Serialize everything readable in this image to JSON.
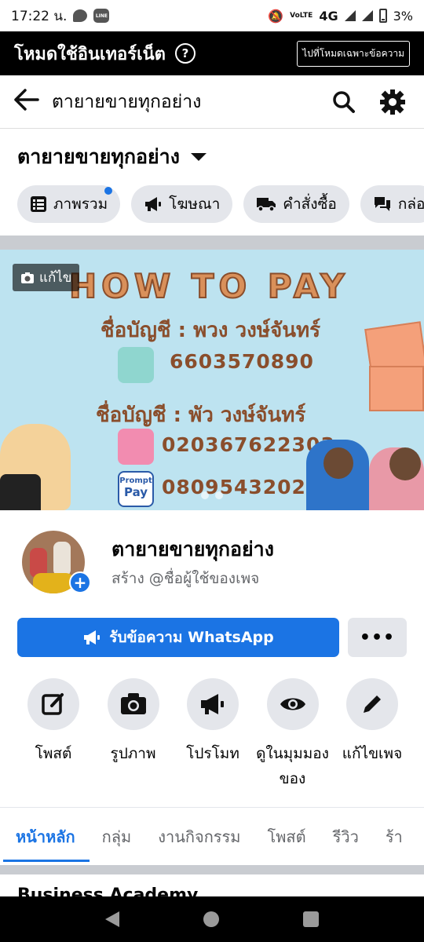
{
  "status": {
    "time": "17:22 น.",
    "battery": "3%",
    "network": "4G",
    "volte": "VoLTE",
    "line_app": "LINE"
  },
  "mode_bar": {
    "title": "โหมดใช้อินเทอร์เน็ต",
    "help": "?",
    "message_mode_label": "ไปที่โหมดเฉพาะข้อความ"
  },
  "search": {
    "query": "ตายายขายทุกอย่าง"
  },
  "page": {
    "title": "ตายายขายทุกอย่าง",
    "name": "ตายายขายทุกอย่าง",
    "username_prompt": "สร้าง @ชื่อผู้ใช้ของเพจ"
  },
  "chips": [
    {
      "label": "ภาพรวม"
    },
    {
      "label": "โฆษณา"
    },
    {
      "label": "คำสั่งซื้อ"
    },
    {
      "label": "กล่อ"
    }
  ],
  "cover": {
    "edit_label": "แก้ไข",
    "headline": "HOW TO PAY",
    "account1_label": "ชื่อบัญชี : พวง วงษ์จันทร์",
    "account1_number": "6603570890",
    "account2_label": "ชื่อบัญชี : พัว วงษ์จันทร์",
    "account2_number": "020367622303",
    "promptpay_number": "0809543202",
    "promptpay_top": "Prompt",
    "promptpay_bottom": "Pay"
  },
  "whatsapp": {
    "label": "รับข้อความ WhatsApp",
    "more": "•••"
  },
  "actions": [
    {
      "label": "โพสต์",
      "icon": "compose-icon"
    },
    {
      "label": "รูปภาพ",
      "icon": "camera-icon"
    },
    {
      "label": "โปรโมท",
      "icon": "megaphone-icon"
    },
    {
      "label": "ดูในมุมมองของ",
      "icon": "eye-icon"
    },
    {
      "label": "แก้ไขเพจ",
      "icon": "pencil-icon"
    }
  ],
  "tabs": [
    {
      "label": "หน้าหลัก"
    },
    {
      "label": "กลุ่ม"
    },
    {
      "label": "งานกิจกรรม"
    },
    {
      "label": "โพสต์"
    },
    {
      "label": "รีวิว"
    },
    {
      "label": "ร้า"
    }
  ],
  "next_section": "Business Academy",
  "colors": {
    "accent": "#1b74e4",
    "chip_bg": "#e4e6eb",
    "cover_bg": "#bde3f0"
  }
}
